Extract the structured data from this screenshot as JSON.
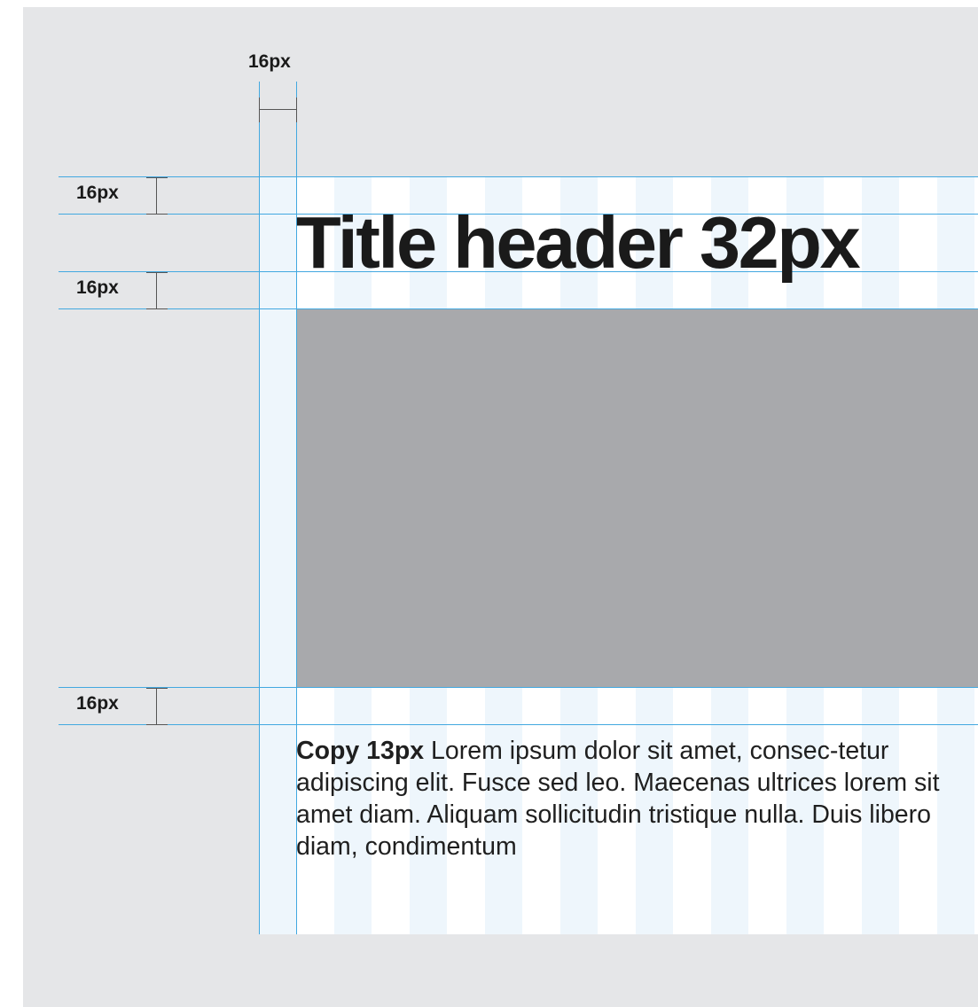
{
  "spacing_diagram": {
    "column_gutter_label": "16px",
    "spacing_labels": [
      "16px",
      "16px",
      "16px"
    ]
  },
  "title": "Title header 32px",
  "copy": {
    "lead": "Copy 13px",
    "text": " Lorem ipsum dolor sit amet, consec-tetur adipiscing elit. Fusce sed leo. Maecenas ultrices lorem sit amet diam. Aliquam sollicitudin tristique nulla. Duis libero diam, condimentum"
  },
  "colors": {
    "background": "#e5e6e8",
    "guide_line": "#42a8e0",
    "column_stripe": "#eef6fc",
    "image_placeholder": "#a8a9ac",
    "text": "#1a1a1a"
  }
}
